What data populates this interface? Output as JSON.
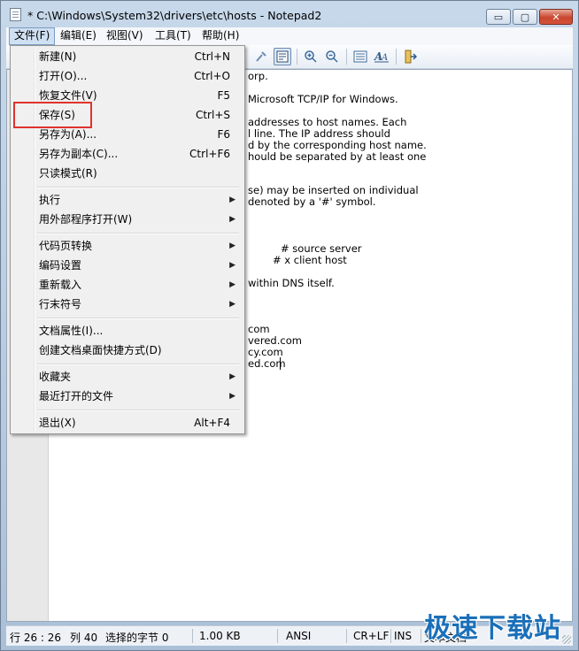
{
  "window": {
    "title": "* C:\\Windows\\System32\\drivers\\etc\\hosts - Notepad2",
    "buttons": {
      "minimize": "▭",
      "maximize": "▢",
      "close": "✕"
    }
  },
  "menubar": [
    "文件(F)",
    "编辑(E)",
    "视图(V)",
    "工具(T)",
    "帮助(H)"
  ],
  "editor": {
    "lines": [
      "orp.",
      "Microsoft TCP/IP for Windows.",
      "addresses to host names. Each",
      "l line. The IP address should",
      "d by the corresponding host name.",
      "hould be separated by at least one",
      "se) may be inserted on individual",
      "denoted by a '#' symbol.",
      "# source server",
      "# x client host",
      "within DNS itself.",
      "com",
      "vered.com",
      "cy.com",
      "ed.com"
    ]
  },
  "file_menu": {
    "items": [
      {
        "label": "新建(N)",
        "accel": "Ctrl+N"
      },
      {
        "label": "打开(O)...",
        "accel": "Ctrl+O"
      },
      {
        "label": "恢复文件(V)",
        "accel": "F5"
      },
      {
        "label": "保存(S)",
        "accel": "Ctrl+S"
      },
      {
        "label": "另存为(A)...",
        "accel": "F6"
      },
      {
        "label": "另存为副本(C)...",
        "accel": "Ctrl+F6"
      },
      {
        "label": "只读模式(R)",
        "accel": ""
      },
      {
        "label": "执行",
        "accel": ""
      },
      {
        "label": "用外部程序打开(W)",
        "accel": ""
      },
      {
        "label": "代码页转换",
        "accel": ""
      },
      {
        "label": "编码设置",
        "accel": ""
      },
      {
        "label": "重新载入",
        "accel": ""
      },
      {
        "label": "行末符号",
        "accel": ""
      },
      {
        "label": "文档属性(I)...",
        "accel": ""
      },
      {
        "label": "创建文档桌面快捷方式(D)",
        "accel": ""
      },
      {
        "label": "收藏夹",
        "accel": ""
      },
      {
        "label": "最近打开的文件",
        "accel": ""
      },
      {
        "label": "退出(X)",
        "accel": "Alt+F4"
      }
    ]
  },
  "statusbar": {
    "position": "行 26 : 26",
    "column": "列 40",
    "selection": "选择的字节 0",
    "size": "1.00 KB",
    "encoding": "ANSI",
    "line_ending": "CR+LF",
    "insert_mode": "INS",
    "doc_type": "文本文档"
  },
  "watermark": "极速下载站",
  "colors": {
    "highlight_box": "#e0322d",
    "watermark": "#1b6fb8"
  }
}
